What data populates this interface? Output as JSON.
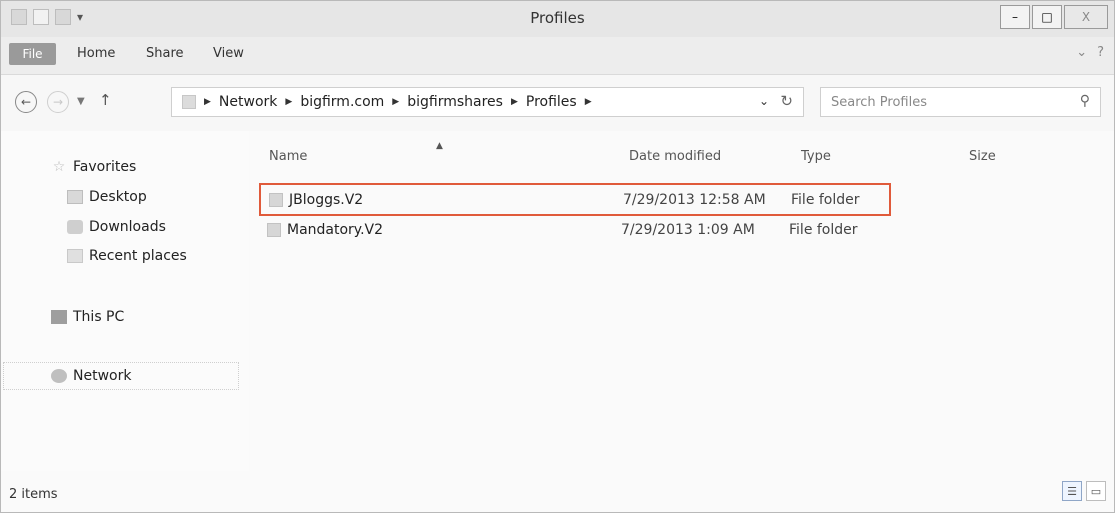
{
  "window": {
    "title": "Profiles",
    "controls": {
      "minimize": "–",
      "maximize": "□",
      "close": "X"
    }
  },
  "ribbon": {
    "tabs": [
      "File",
      "Home",
      "Share",
      "View"
    ],
    "expand_icon": "chevron-down-icon",
    "help_icon": "help-icon"
  },
  "navigation": {
    "breadcrumb": [
      "Network",
      "bigfirm.com",
      "bigfirmshares",
      "Profiles"
    ],
    "search_placeholder": "Search Profiles"
  },
  "nav_pane": {
    "favorites": "Favorites",
    "desktop": "Desktop",
    "downloads": "Downloads",
    "recent": "Recent places",
    "this_pc": "This PC",
    "network": "Network"
  },
  "columns": {
    "name": "Name",
    "date": "Date modified",
    "type": "Type",
    "size": "Size"
  },
  "files": [
    {
      "name": "JBloggs.V2",
      "date": "7/29/2013 12:58 AM",
      "type": "File folder",
      "selected": true
    },
    {
      "name": "Mandatory.V2",
      "date": "7/29/2013 1:09 AM",
      "type": "File folder",
      "selected": false
    }
  ],
  "status": {
    "count": "2 items"
  },
  "colors": {
    "selection_outline": "#e05a3a",
    "file_tab": "#9a9a9a"
  }
}
